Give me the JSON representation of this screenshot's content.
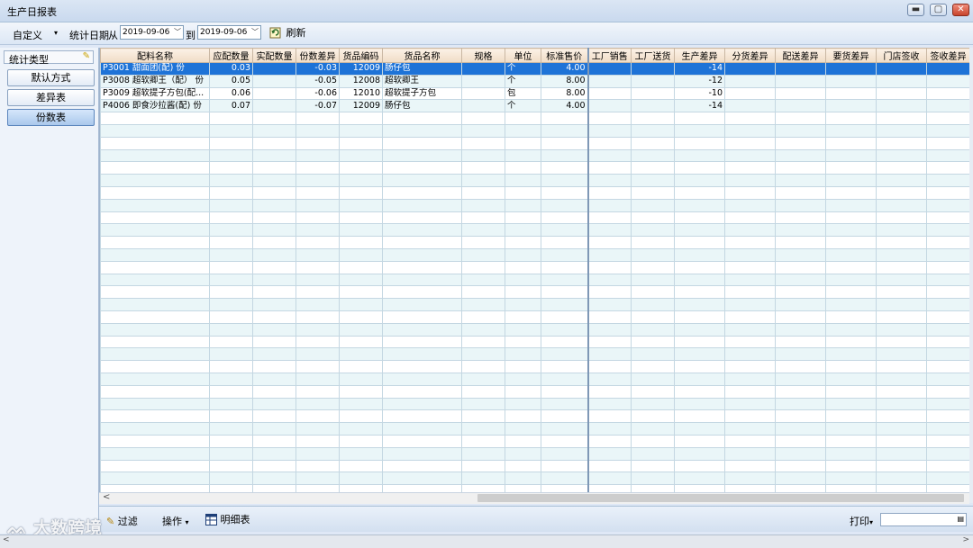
{
  "window": {
    "title": "生产日报表",
    "min_icon": "minimize-icon",
    "max_icon": "maximize-icon",
    "close_icon": "close-icon"
  },
  "toolbar": {
    "custom_label": "自定义",
    "custom_arrow": "▾",
    "date_label": "统计日期",
    "from_label": "从",
    "from_date": "2019-09-06",
    "to_label": "到",
    "to_date": "2019-09-06",
    "refresh_label": "刷新",
    "dropdown_glyph": "﹀"
  },
  "sidebar": {
    "header_label": "统计类型",
    "pin_glyph": "✎",
    "items": [
      {
        "label": "默认方式",
        "active": false
      },
      {
        "label": "差异表",
        "active": false
      },
      {
        "label": "份数表",
        "active": true
      }
    ]
  },
  "grid": {
    "columns": [
      "配料名称",
      "应配数量",
      "实配数量",
      "份数差异",
      "货品编码",
      "货品名称",
      "规格",
      "单位",
      "标准售价",
      "工厂销售",
      "工厂送货",
      "生产差异",
      "分货差异",
      "配送差异",
      "要货差异",
      "门店签收",
      "签收差异"
    ],
    "rows": [
      {
        "selected": true,
        "cells": [
          "P3001 甜面团(配) 份",
          "0.03",
          "",
          "-0.03",
          "12009",
          "肠仔包",
          "",
          "个",
          "4.00",
          "",
          "",
          "-14",
          "",
          "",
          "",
          "",
          ""
        ]
      },
      {
        "selected": false,
        "cells": [
          "P3008 超软卿王（配） 份",
          "0.05",
          "",
          "-0.05",
          "12008",
          "超软卿王",
          "",
          "个",
          "8.00",
          "",
          "",
          "-12",
          "",
          "",
          "",
          "",
          ""
        ]
      },
      {
        "selected": false,
        "cells": [
          "P3009 超软提子方包(配...",
          "0.06",
          "",
          "-0.06",
          "12010",
          "超软提子方包",
          "",
          "包",
          "8.00",
          "",
          "",
          "-10",
          "",
          "",
          "",
          "",
          ""
        ]
      },
      {
        "selected": false,
        "cells": [
          "P4006 即食沙拉酱(配) 份",
          "0.07",
          "",
          "-0.07",
          "12009",
          "肠仔包",
          "",
          "个",
          "4.00",
          "",
          "",
          "-14",
          "",
          "",
          "",
          "",
          ""
        ]
      }
    ]
  },
  "scroll": {
    "left_arrow": "<"
  },
  "bottombar": {
    "filter_label": "过滤",
    "operate_label": "操作",
    "operate_arrow": "▾",
    "detail_label": "明细表",
    "print_label": "打印",
    "print_arrow": "▾"
  },
  "watermark": "大数跨境",
  "statusbar": {
    "left": "<",
    "right": ">"
  }
}
